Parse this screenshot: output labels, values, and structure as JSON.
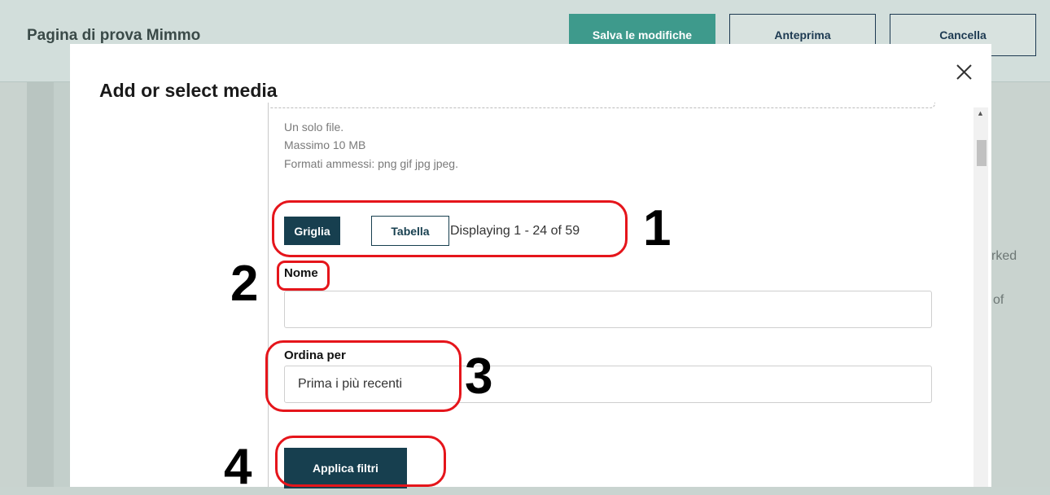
{
  "background": {
    "page_title": "Pagina di prova Mimmo",
    "buttons": {
      "save": "Salva le modifiche",
      "preview": "Anteprima",
      "cancel": "Cancella"
    },
    "partial_text": [
      "rked",
      "of"
    ]
  },
  "modal": {
    "title": "Add or select media",
    "close_icon": "close-icon",
    "upload_info": [
      "Un solo file.",
      "Massimo 10 MB",
      "Formati ammessi: png gif jpg jpeg."
    ],
    "view_toggle": {
      "grid_label": "Griglia",
      "table_label": "Tabella",
      "displaying": "Displaying 1 - 24 of 59"
    },
    "filters": {
      "name_label": "Nome",
      "name_value": "",
      "sort_label": "Ordina per",
      "sort_value": "Prima i più recenti",
      "apply_label": "Applica filtri"
    }
  },
  "annotations": [
    "1",
    "2",
    "3",
    "4"
  ],
  "colors": {
    "accent": "#173f4f",
    "save_button": "#3e9a8c",
    "annotation": "#e5151b"
  }
}
